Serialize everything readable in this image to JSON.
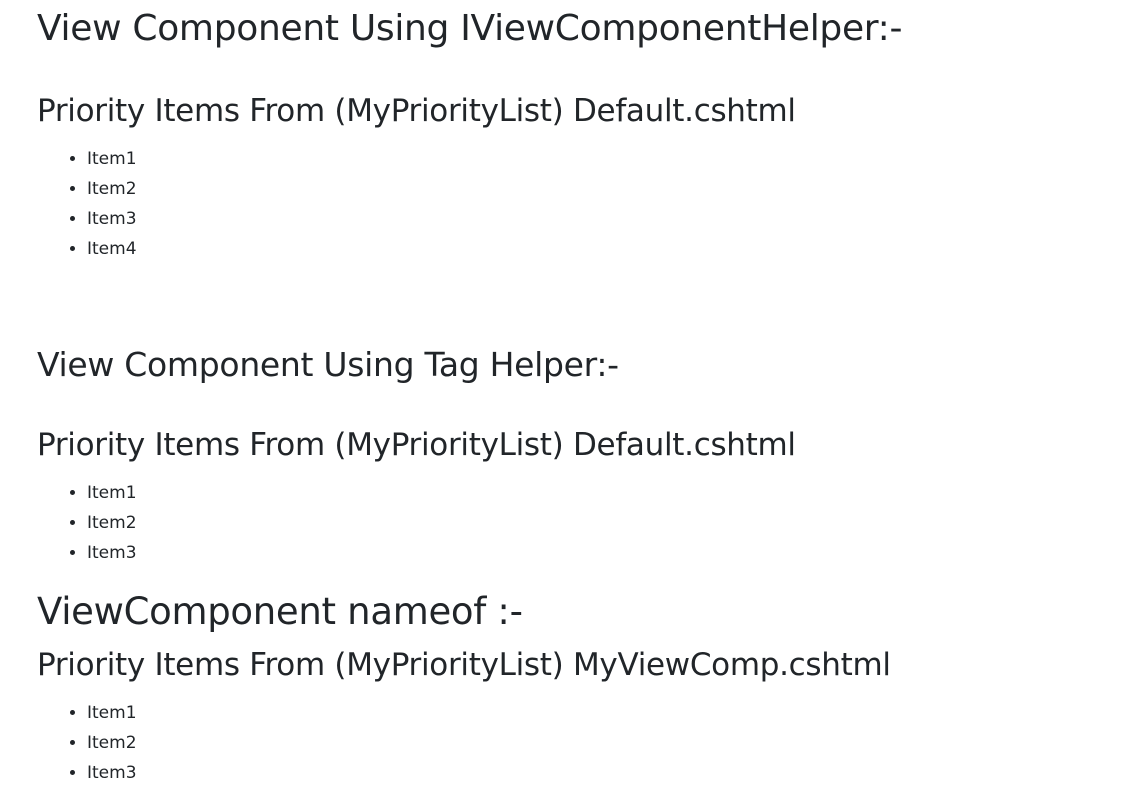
{
  "section1": {
    "heading": "View Component Using IViewComponentHelper:-",
    "subheading": "Priority Items From (MyPriorityList) Default.cshtml",
    "items": [
      "Item1",
      "Item2",
      "Item3",
      "Item4"
    ]
  },
  "section2": {
    "heading": "View Component Using Tag Helper:-",
    "subheading": "Priority Items From (MyPriorityList) Default.cshtml",
    "items": [
      "Item1",
      "Item2",
      "Item3"
    ]
  },
  "section3": {
    "heading": "ViewComponent nameof :-",
    "subheading": "Priority Items From (MyPriorityList) MyViewComp.cshtml",
    "items": [
      "Item1",
      "Item2",
      "Item3"
    ]
  }
}
